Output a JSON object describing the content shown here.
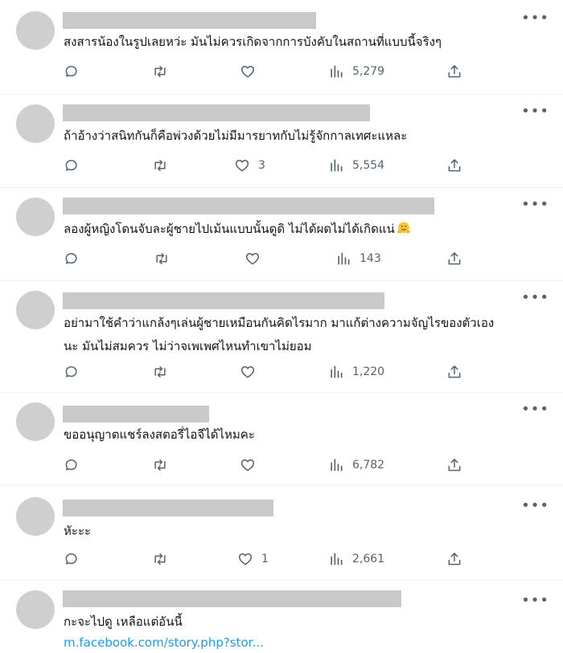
{
  "replies": [
    {
      "text": [
        "สงสารน้องในรูปเลยหว่ะ มันไม่ควรเกิดจากการบังคับในสถานที่แบบนี้จริงๆ"
      ],
      "likes": "",
      "views": "5,279"
    },
    {
      "text": [
        "ถ้าอ้างว่าสนิทกันก็คือพ่วงด้วยไม่มีมารยาทกับไม่รู้จักกาลเทศะแหละ"
      ],
      "likes": "3",
      "views": "5,554"
    },
    {
      "text": [
        "ลองผู้หญิงโดนจับละผู้ชายไปเม้นแบบนั้นดูดิ ไม่ได้ผดไม่ได้เกิดแน่"
      ],
      "emoji": "hugging-face-emoji",
      "likes": "",
      "views": "143"
    },
    {
      "text": [
        "อย่ามาใช้คำว่าแกล้งๆเล่นผู้ชายเหมือนกันคิดไรมาก  มาแก้ต่างความจัญไรของตัวเอง",
        "นะ มันไม่สมควร ไม่ว่าจเพเพศไหนทำเขาไม่ยอม"
      ],
      "likes": "",
      "views": "1,220"
    },
    {
      "text": [
        "ขออนุญาตแชร์ลงสตอรี่ไอจีได้ไหมคะ"
      ],
      "likes": "",
      "views": "6,782"
    },
    {
      "text": [
        "หัะะะ"
      ],
      "likes": "1",
      "views": "2,661"
    },
    {
      "text": [
        "กะจะไปดู เหลือแต่อันนี้"
      ],
      "link": "m.facebook.com/story.php?stor..."
    }
  ],
  "icons": {
    "reply": "reply-icon",
    "retweet": "retweet-icon",
    "like": "heart-icon",
    "views": "views-icon",
    "share": "share-icon",
    "more": "more-icon"
  },
  "colors": {
    "text": "#0f1419",
    "muted": "#536471",
    "link": "#1d9bf0",
    "divider": "#eff3f4",
    "placeholder": "#c9c9c9"
  }
}
